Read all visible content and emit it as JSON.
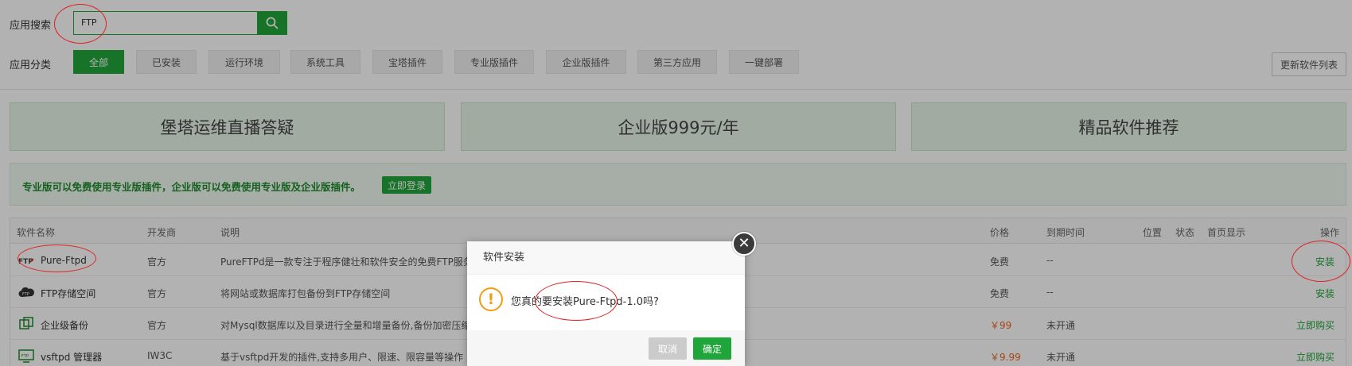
{
  "search": {
    "label": "应用搜索",
    "value": "FTP"
  },
  "category": {
    "label": "应用分类",
    "items": [
      "全部",
      "已安装",
      "运行环境",
      "系统工具",
      "宝塔插件",
      "专业版插件",
      "企业版插件",
      "第三方应用",
      "一键部署"
    ],
    "active_index": 0
  },
  "refresh_button": "更新软件列表",
  "banners": [
    "堡塔运维直播答疑",
    "企业版999元/年",
    "精品软件推荐"
  ],
  "notice": {
    "text": "专业版可以免费使用专业版插件，企业版可以免费使用专业版及企业版插件。",
    "login_button": "立即登录"
  },
  "table": {
    "headers": {
      "name": "软件名称",
      "dev": "开发商",
      "desc": "说明",
      "price": "价格",
      "expire": "到期时间",
      "position": "位置",
      "status": "状态",
      "home": "首页显示",
      "action": "操作"
    },
    "rows": [
      {
        "name": "Pure-Ftpd",
        "dev": "官方",
        "desc": "PureFTPd是一款专注于程序健壮和软件安全的免费FTP服务",
        "price": "免费",
        "expire": "--",
        "action": "安装",
        "icon": "ftp-icon"
      },
      {
        "name": "FTP存储空间",
        "dev": "官方",
        "desc": "将网站或数据库打包备份到FTP存储空间",
        "price": "免费",
        "expire": "--",
        "action": "安装",
        "icon": "cloud-ftp-icon"
      },
      {
        "name": "企业级备份",
        "dev": "官方",
        "desc": "对Mysql数据库以及目录进行全量和增量备份,备份加密压缩",
        "price": "￥99",
        "expire": "未开通",
        "action": "立即购买",
        "icon": "backup-icon"
      },
      {
        "name": "vsftpd 管理器",
        "dev": "IW3C",
        "desc": "基于vsftpd开发的插件,支持多用户、限速、限容量等操作",
        "price": "￥9.99",
        "expire": "未开通",
        "action": "立即购买",
        "icon": "vsftpd-icon"
      }
    ]
  },
  "dialog": {
    "title": "软件安装",
    "message": "您真的要安装Pure-Ftpd-1.0吗?",
    "cancel": "取消",
    "confirm": "确定"
  },
  "colors": {
    "accent": "#20a53a",
    "price_paid": "#f0641e",
    "warning": "#f39c12",
    "annotation": "#e02020"
  }
}
